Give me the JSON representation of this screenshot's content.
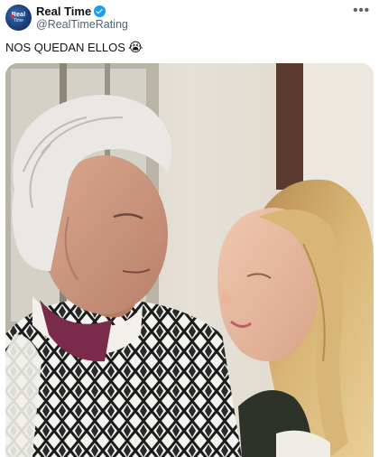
{
  "tweet": {
    "author_name": "Real Time",
    "author_handle": "@RealTimeRating",
    "avatar_text_top": "Real",
    "avatar_text_bottom": "Time",
    "more_label": "•••",
    "text": "NOS QUEDAN ELLOS",
    "emoji": "😭"
  },
  "colors": {
    "verified": "#1d9bf0",
    "handle": "#536471",
    "text": "#0f1419"
  },
  "icons": {
    "verified": "verified-badge-icon",
    "more": "more-options-icon"
  }
}
